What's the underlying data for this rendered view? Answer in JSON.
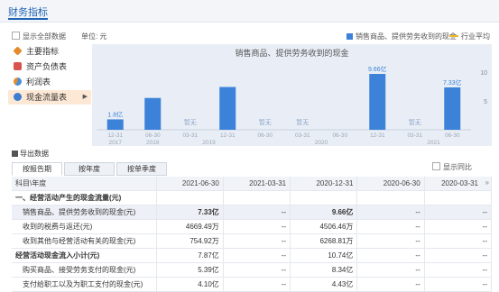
{
  "header": {
    "title": "财务指标"
  },
  "toolbar": {
    "show_all": "显示全部数据",
    "unit": "单位: 元",
    "legend_bar": "销售商品、提供劳务收到的现金",
    "legend_line": "行业平均"
  },
  "menu": {
    "items": [
      {
        "label": "主要指标",
        "icon": "diamond-icon",
        "color": "#e58a2b"
      },
      {
        "label": "资产负债表",
        "icon": "document-icon",
        "color": "#d9534f"
      },
      {
        "label": "利润表",
        "icon": "pie-icon",
        "color": "#4a90d9"
      },
      {
        "label": "现金流量表",
        "icon": "coin-icon",
        "color": "#3c7dd0",
        "arrow": "▶"
      }
    ]
  },
  "colors": {
    "accent": "#1f63b5",
    "bar": "#3b82d8",
    "line": "#f2b825",
    "chart_bg": "#e9eef6"
  },
  "chart_data": {
    "type": "bar",
    "title": "销售商品、提供劳务收到的现金",
    "categories": [
      "12-31",
      "06-30",
      "03-31",
      "12-31",
      "06-30",
      "03-31",
      "06-30",
      "12-31",
      "03-31",
      "06-30"
    ],
    "years": [
      {
        "label": "2017",
        "from": 0,
        "to": 0
      },
      {
        "label": "2018",
        "from": 1,
        "to": 1
      },
      {
        "label": "2019",
        "from": 2,
        "to": 3
      },
      {
        "label": "2020",
        "from": 4,
        "to": 7
      },
      {
        "label": "2021",
        "from": 8,
        "to": 9
      }
    ],
    "values": [
      1.8,
      5.5,
      null,
      7.4,
      null,
      null,
      null,
      9.66,
      null,
      7.33
    ],
    "data_labels": [
      "1.8亿",
      "",
      "暂无",
      "",
      "暂无",
      "暂无",
      "",
      "9.66亿",
      "暂无",
      "7.33亿"
    ],
    "y_ticks": [
      5,
      10
    ],
    "ylim": [
      0,
      12
    ]
  },
  "export_label": "导出数据",
  "tabs": [
    "按报告期",
    "按年度",
    "按单季度"
  ],
  "compare_label": "显示同比",
  "table": {
    "columns": [
      "科目\\年度",
      "2021-06-30",
      "2021-03-31",
      "2020-12-31",
      "2020-06-30",
      "2020-03-31"
    ],
    "more": "»",
    "rows": [
      {
        "cells": [
          "一、经营活动产生的现金流量(元)",
          "",
          "",
          "",
          "",
          ""
        ],
        "type": "sec"
      },
      {
        "cells": [
          "销售商品、提供劳务收到的现金(元)",
          "7.33亿",
          "--",
          "9.66亿",
          "--",
          "--"
        ],
        "type": "hl"
      },
      {
        "cells": [
          "收到的税费与返还(元)",
          "4669.49万",
          "--",
          "4506.46万",
          "--",
          "--"
        ],
        "type": "ind"
      },
      {
        "cells": [
          "收到其他与经营活动有关的现金(元)",
          "754.92万",
          "--",
          "6268.81万",
          "--",
          "--"
        ],
        "type": "ind"
      },
      {
        "cells": [
          "经营活动现金流入小计(元)",
          "7.87亿",
          "--",
          "10.74亿",
          "--",
          "--"
        ],
        "type": "sec"
      },
      {
        "cells": [
          "购买商品、接受劳务支付的现金(元)",
          "5.39亿",
          "--",
          "8.34亿",
          "--",
          "--"
        ],
        "type": "ind"
      },
      {
        "cells": [
          "支付给职工以及为职工支付的现金(元)",
          "4.10亿",
          "--",
          "4.43亿",
          "--",
          "--"
        ],
        "type": "ind"
      }
    ]
  }
}
